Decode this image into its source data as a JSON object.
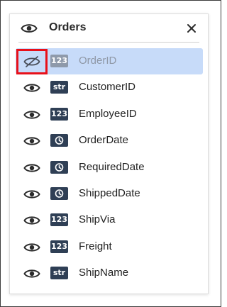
{
  "panel": {
    "title": "Orders",
    "close_icon": "close-icon",
    "header_icon": "eye-icon"
  },
  "colors": {
    "selected_row": "#c7dbf9",
    "badge": "#2f3f55",
    "badge_dimmed": "#8f9aaa",
    "highlight": "#e8101a"
  },
  "fields": [
    {
      "name": "OrderID",
      "type": "123",
      "icon": "number-type-icon",
      "visibility": "hidden",
      "selected": true
    },
    {
      "name": "CustomerID",
      "type": "str",
      "icon": "string-type-icon",
      "visibility": "visible",
      "selected": false
    },
    {
      "name": "EmployeeID",
      "type": "123",
      "icon": "number-type-icon",
      "visibility": "visible",
      "selected": false
    },
    {
      "name": "OrderDate",
      "type": "",
      "icon": "clock-icon",
      "visibility": "visible",
      "selected": false
    },
    {
      "name": "RequiredDate",
      "type": "",
      "icon": "clock-icon",
      "visibility": "visible",
      "selected": false
    },
    {
      "name": "ShippedDate",
      "type": "",
      "icon": "clock-icon",
      "visibility": "visible",
      "selected": false
    },
    {
      "name": "ShipVia",
      "type": "123",
      "icon": "number-type-icon",
      "visibility": "visible",
      "selected": false
    },
    {
      "name": "Freight",
      "type": "123",
      "icon": "number-type-icon",
      "visibility": "visible",
      "selected": false
    },
    {
      "name": "ShipName",
      "type": "str",
      "icon": "string-type-icon",
      "visibility": "visible",
      "selected": false
    }
  ]
}
